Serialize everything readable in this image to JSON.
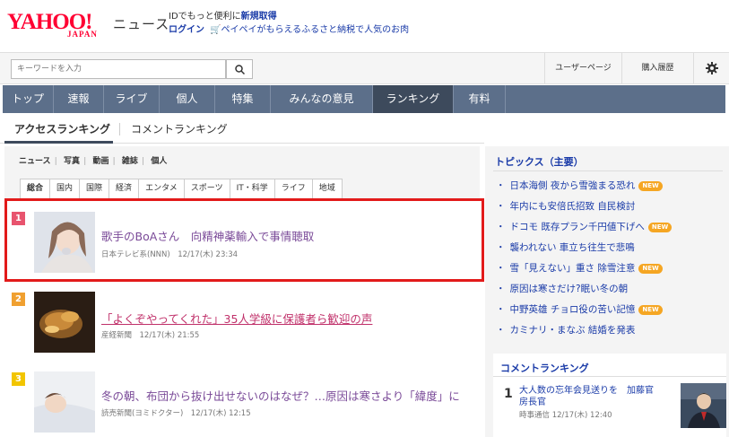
{
  "header": {
    "logo_text": "YAHOO!",
    "logo_sub": "JAPAN",
    "section_title": "ニュース",
    "promo_line1_prefix": "IDでもっと便利に",
    "promo_line1_link": "新規取得",
    "login_label": "ログイン",
    "promo_line2": "ペイペイがもらえるふるさと納税で人気のお肉"
  },
  "search": {
    "placeholder": "キーワードを入力",
    "user_page_label": "ユーザーページ",
    "purchase_history_label": "購入履歴"
  },
  "nav": {
    "items": [
      "トップ",
      "速報",
      "ライブ",
      "個人",
      "特集",
      "みんなの意見",
      "ランキング",
      "有料"
    ],
    "active_index": 6
  },
  "subtabs": {
    "access_ranking": "アクセスランキング",
    "comment_ranking": "コメントランキング"
  },
  "categories": {
    "top_links": [
      "ニュース",
      "写真",
      "動画",
      "雑誌",
      "個人"
    ],
    "tabs": [
      "総合",
      "国内",
      "国際",
      "経済",
      "エンタメ",
      "スポーツ",
      "IT・科学",
      "ライフ",
      "地域"
    ]
  },
  "ranking": [
    {
      "rank": "1",
      "title": "歌手のBoAさん　向精神薬輸入で事情聴取",
      "meta": "日本テレビ系(NNN)　12/17(木) 23:34",
      "badge_color": "#e8546e"
    },
    {
      "rank": "2",
      "title": "「よくぞやってくれた」35人学級に保護者ら歓迎の声",
      "meta": "産経新聞　12/17(木) 21:55",
      "badge_color": "#f0a030"
    },
    {
      "rank": "3",
      "title": "冬の朝、布団から抜け出せないのはなぜ？…原因は寒さより「緯度」に",
      "meta": "読売新聞(ヨミドクター)　12/17(木) 12:15",
      "badge_color": "#f2c500"
    }
  ],
  "topics": {
    "heading": "トピックス（主要）",
    "items": [
      {
        "text": "日本海側 夜から雪強まる恐れ",
        "is_new": true
      },
      {
        "text": "年内にも安倍氏招致 自民検討",
        "is_new": false
      },
      {
        "text": "ドコモ 既存プラン千円値下げへ",
        "is_new": true
      },
      {
        "text": "襲われない 車立ち往生で悲鳴",
        "is_new": false
      },
      {
        "text": "雪「見えない」重さ 除雪注意",
        "is_new": true
      },
      {
        "text": "原因は寒さだけ?眠い冬の朝",
        "is_new": false
      },
      {
        "text": "中野英雄 チョロ役の苦い記憶",
        "is_new": true
      },
      {
        "text": "カミナリ・まなぶ 結婚を発表",
        "is_new": false
      }
    ],
    "new_label": "NEW"
  },
  "comment_ranking": {
    "heading": "コメントランキング",
    "rank": "1",
    "title": "大人数の忘年会見送りを　加藤官房長官",
    "meta": "時事通信 12/17(木) 12:40"
  }
}
